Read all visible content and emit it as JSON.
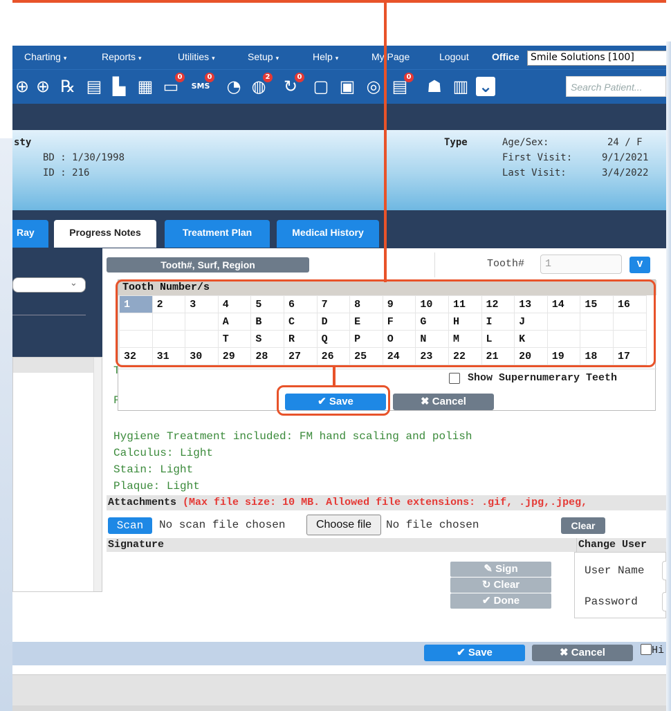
{
  "menu": {
    "items": [
      {
        "label": "Charting"
      },
      {
        "label": "Reports"
      },
      {
        "label": "Utilities"
      },
      {
        "label": "Setup"
      },
      {
        "label": "Help"
      }
    ],
    "my_page": "My Page",
    "logout": "Logout",
    "office_label": "Office",
    "office_value": "Smile Solutions [100]",
    "caret": "▾"
  },
  "toolbar": {
    "icons": [
      {
        "name": "add-patient-icon",
        "glyph": "⊕"
      },
      {
        "name": "patients-icon",
        "glyph": "⊕"
      },
      {
        "name": "prescription-icon",
        "glyph": "℞"
      },
      {
        "name": "notes-icon",
        "glyph": "▤"
      },
      {
        "name": "printer-form-icon",
        "glyph": "▙"
      },
      {
        "name": "letter-icon",
        "glyph": "▦"
      },
      {
        "name": "chat-icon",
        "glyph": "▭",
        "badge": "0"
      },
      {
        "name": "sms-icon",
        "glyph": "SMS",
        "badge": "0"
      },
      {
        "name": "clock-icon",
        "glyph": "◔"
      },
      {
        "name": "globe-icon",
        "glyph": "◍",
        "badge": "2"
      },
      {
        "name": "refresh-icon",
        "glyph": "↻",
        "badge": "0"
      },
      {
        "name": "tooth-icon",
        "glyph": "▢"
      },
      {
        "name": "calendar-icon",
        "glyph": "▣"
      },
      {
        "name": "web-icon",
        "glyph": "◎"
      },
      {
        "name": "document-icon",
        "glyph": "▤",
        "badge": "0"
      },
      {
        "name": "family-icon",
        "glyph": "☗"
      },
      {
        "name": "print-icon",
        "glyph": "▥"
      },
      {
        "name": "collapse-icon",
        "glyph": "⌄"
      }
    ],
    "search_placeholder": "Search Patient..."
  },
  "patient": {
    "name_fragment": "sty",
    "bd": "BD : 1/30/1998",
    "id": "ID : 216",
    "type_label": "Type",
    "age_sex_label": "Age/Sex:",
    "age_sex": "24 / F",
    "first_visit_label": "First Visit:",
    "first_visit": "9/1/2021",
    "last_visit_label": "Last Visit:",
    "last_visit": "3/4/2022"
  },
  "tabs": [
    {
      "label": "Ray"
    },
    {
      "label": "Progress Notes"
    },
    {
      "label": "Treatment Plan"
    },
    {
      "label": "Medical History"
    }
  ],
  "tooth_toolbar": {
    "region_button": "Tooth#, Surf, Region",
    "tooth_label": "Tooth#",
    "tooth_value": "1",
    "v_button": "V"
  },
  "tooth_popup": {
    "title": "Tooth Number/s",
    "rows": [
      [
        "1",
        "2",
        "3",
        "4",
        "5",
        "6",
        "7",
        "8",
        "9",
        "10",
        "11",
        "12",
        "13",
        "14",
        "15",
        "16"
      ],
      [
        "",
        "",
        "",
        "A",
        "B",
        "C",
        "D",
        "E",
        "F",
        "G",
        "H",
        "I",
        "J",
        "",
        "",
        ""
      ],
      [
        "",
        "",
        "",
        "T",
        "S",
        "R",
        "Q",
        "P",
        "O",
        "N",
        "M",
        "L",
        "K",
        "",
        "",
        ""
      ],
      [
        "32",
        "31",
        "30",
        "29",
        "28",
        "27",
        "26",
        "25",
        "24",
        "23",
        "22",
        "21",
        "20",
        "19",
        "18",
        "17"
      ]
    ],
    "selected": "1",
    "supernumerary_label": "Show Supernumerary Teeth",
    "save": "✔ Save",
    "cancel": "✖ Cancel"
  },
  "note": {
    "fragment1": "T",
    "fragment2": "F",
    "lines": [
      "Hygiene Treatment included: FM hand scaling and polish",
      "Calculus: Light",
      "Stain: Light",
      "Plaque: Light"
    ]
  },
  "attachments": {
    "label": "Attachments",
    "info": "(Max file size: 10 MB. Allowed file extensions: .gif, .jpg,.jpeg,",
    "scan": "Scan",
    "no_scan": "No scan file chosen",
    "choose_file": "Choose file",
    "no_file": "No file chosen",
    "clear": "Clear"
  },
  "signature": {
    "label": "Signature",
    "change_user": "Change User",
    "sign": "✎ Sign",
    "clear": "↻ Clear",
    "done": "✔ Done",
    "user_name": "User Name",
    "password": "Password"
  },
  "bottom": {
    "save": "✔ Save",
    "cancel": "✖ Cancel",
    "hide_label": "Hi"
  },
  "colors": {
    "accent": "#1e88e5",
    "menu_bg": "#1f5fa8",
    "callout": "#e8532a",
    "note_text": "#3a8a3a"
  }
}
